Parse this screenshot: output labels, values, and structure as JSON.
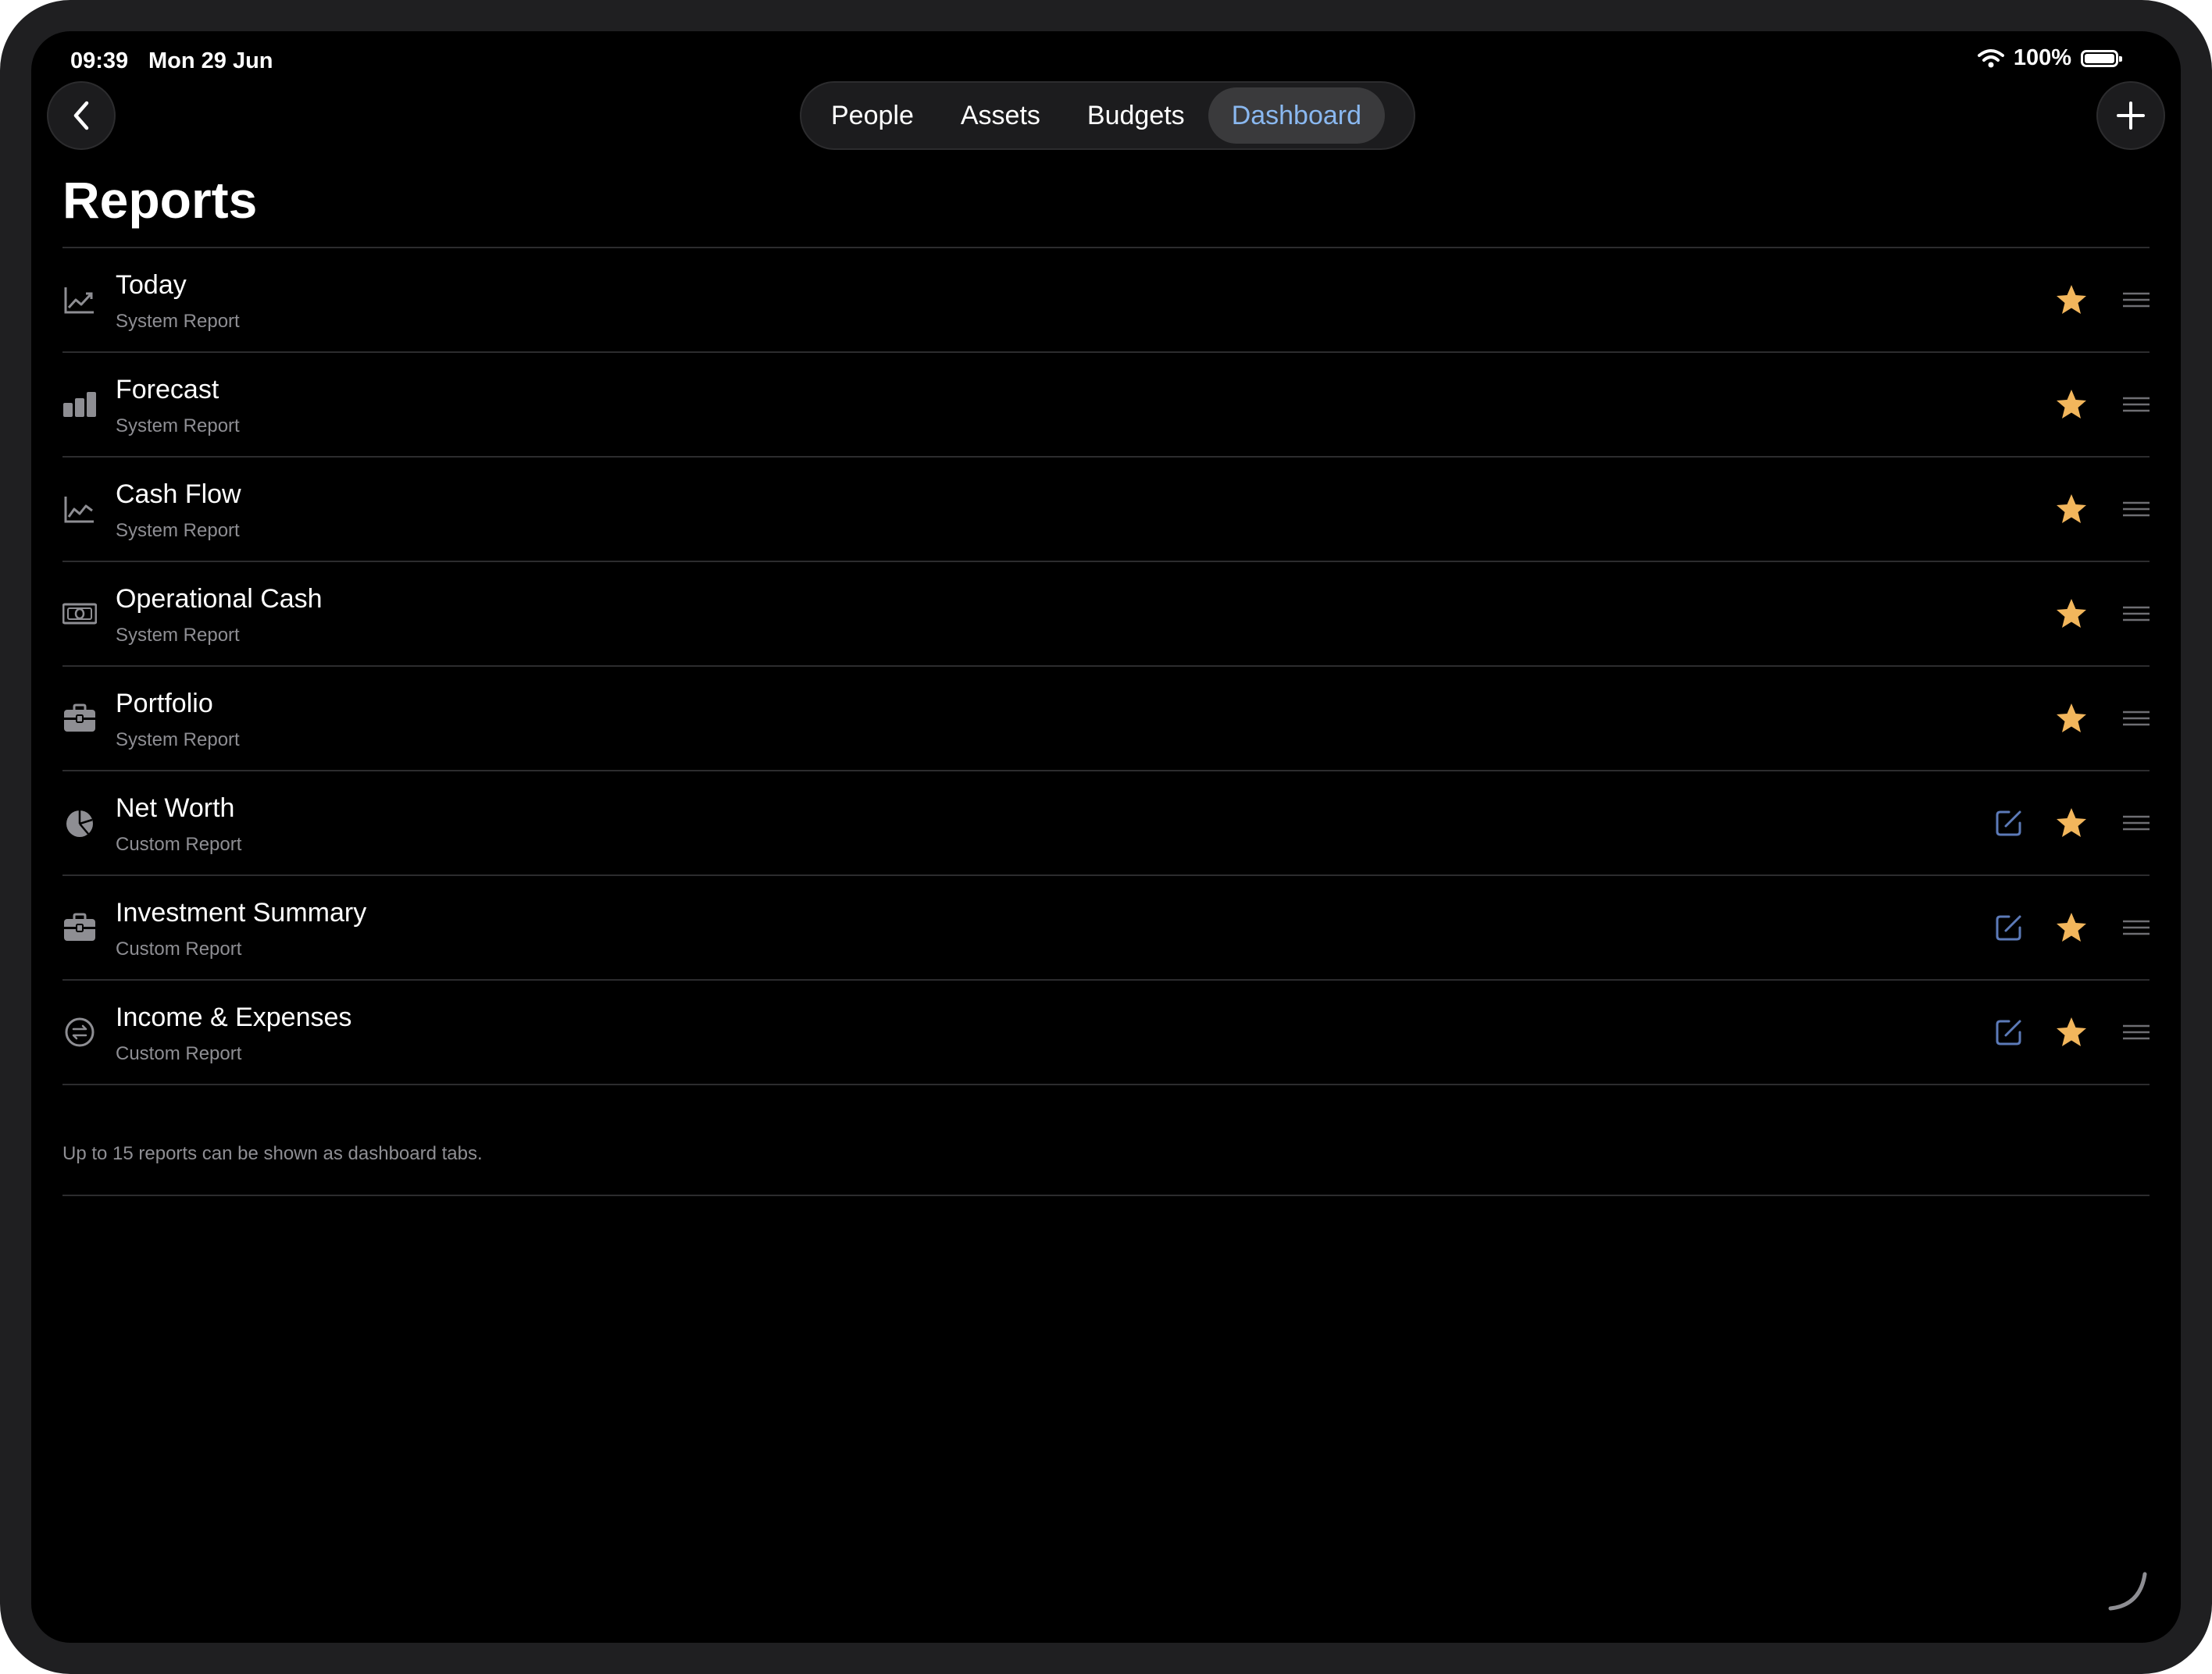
{
  "status_bar": {
    "time": "09:39",
    "date": "Mon 29 Jun",
    "battery": "100%"
  },
  "nav": {
    "back_icon": "chevron-left-icon",
    "add_icon": "plus-icon",
    "tabs": [
      {
        "label": "People",
        "active": false
      },
      {
        "label": "Assets",
        "active": false
      },
      {
        "label": "Budgets",
        "active": false
      },
      {
        "label": "Dashboard",
        "active": true
      }
    ]
  },
  "page": {
    "title": "Reports",
    "footer_note": "Up to 15 reports can be shown as dashboard tabs."
  },
  "reports": [
    {
      "title": "Today",
      "subtitle": "System Report",
      "icon": "line-chart-icon",
      "editable": false,
      "starred": true
    },
    {
      "title": "Forecast",
      "subtitle": "System Report",
      "icon": "bar-chart-icon",
      "editable": false,
      "starred": true
    },
    {
      "title": "Cash Flow",
      "subtitle": "System Report",
      "icon": "line-chart-icon",
      "editable": false,
      "starred": true
    },
    {
      "title": "Operational Cash",
      "subtitle": "System Report",
      "icon": "banknote-icon",
      "editable": false,
      "starred": true
    },
    {
      "title": "Portfolio",
      "subtitle": "System Report",
      "icon": "briefcase-icon",
      "editable": false,
      "starred": true
    },
    {
      "title": "Net Worth",
      "subtitle": "Custom Report",
      "icon": "pie-chart-icon",
      "editable": true,
      "starred": true
    },
    {
      "title": "Investment Summary",
      "subtitle": "Custom Report",
      "icon": "briefcase-icon",
      "editable": true,
      "starred": true
    },
    {
      "title": "Income & Expenses",
      "subtitle": "Custom Report",
      "icon": "currency-exchange-icon",
      "editable": true,
      "starred": true
    }
  ],
  "colors": {
    "background": "#000000",
    "accent_blue": "#8ab8f0",
    "edit_icon": "#5c7ab8",
    "star": "#f2b65c",
    "secondary_text": "#8e8e93",
    "separator": "#2c2c2e"
  }
}
